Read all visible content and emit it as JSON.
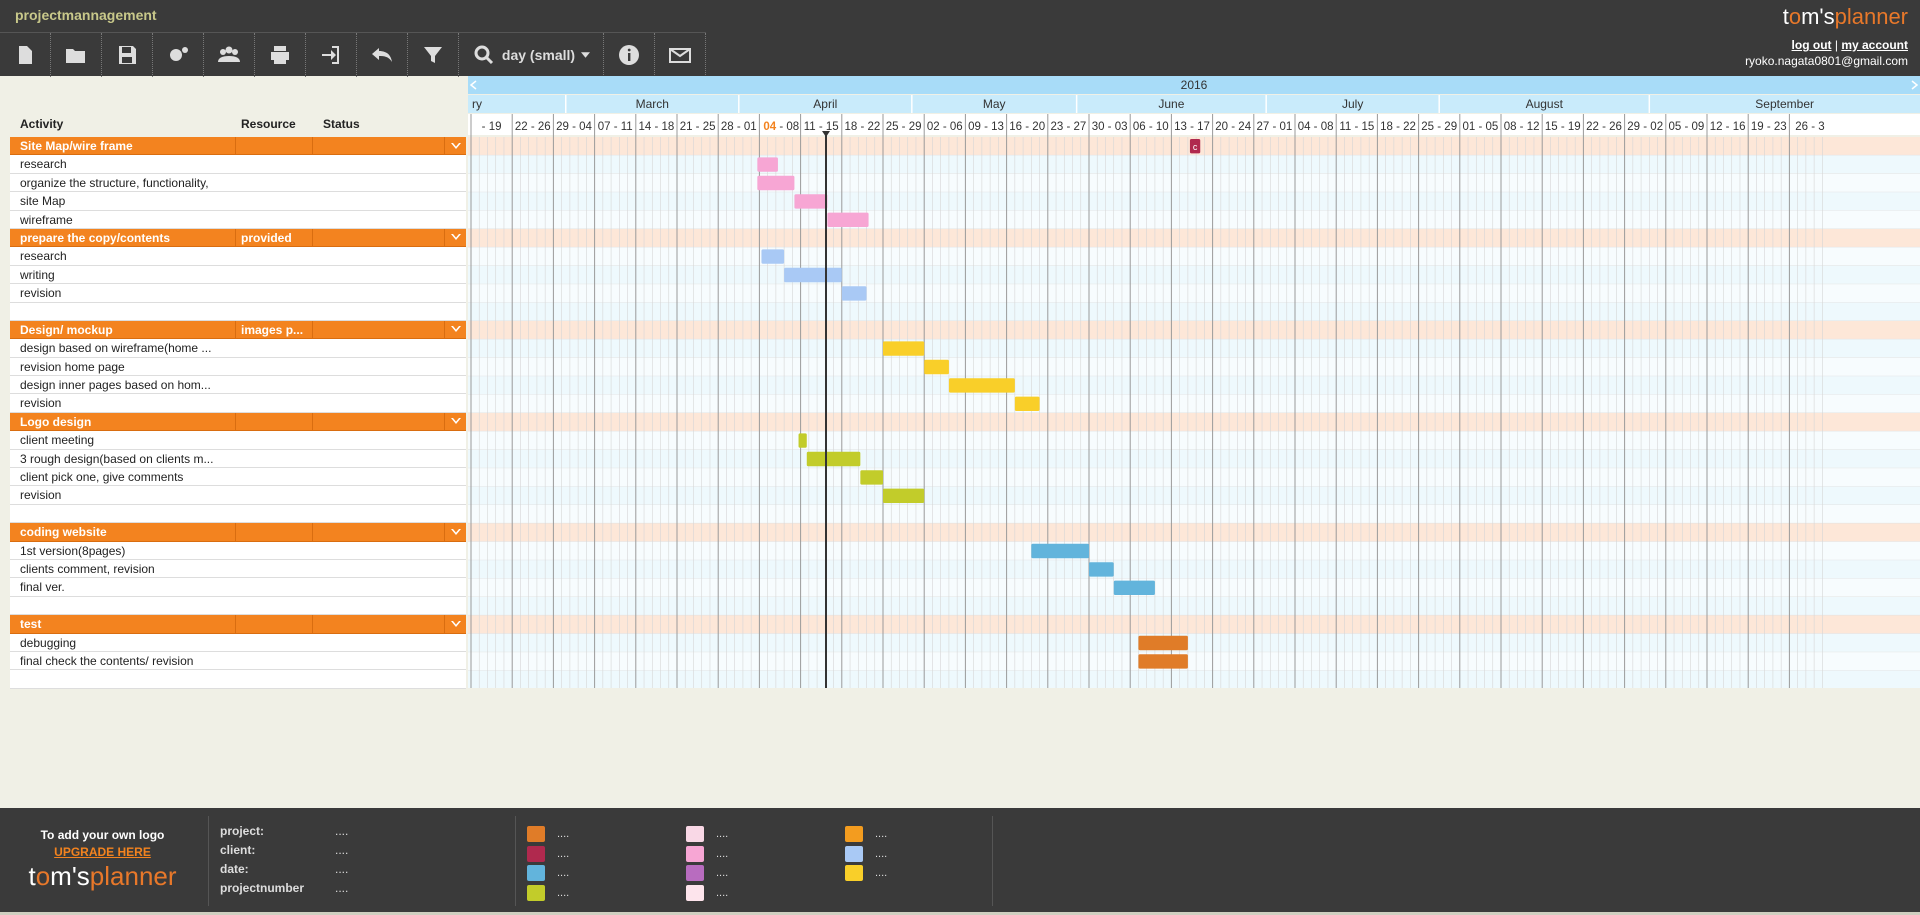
{
  "app": {
    "name": "projectmannagement",
    "logo_pre": "t",
    "logo_mid": "m's",
    "logo_post": "planner",
    "logout": "log out",
    "sep": " | ",
    "myaccount": "my account",
    "user": "ryoko.nagata0801@gmail.com"
  },
  "toolbar": {
    "zoom": "day (small)",
    "icons": [
      "new-file-icon",
      "open-folder-icon",
      "save-icon",
      "settings-icon",
      "users-icon",
      "print-icon",
      "export-icon",
      "undo-icon",
      "filter-icon",
      "zoom-search-icon",
      "info-icon",
      "mail-icon"
    ]
  },
  "columns": {
    "activity": "Activity",
    "resource": "Resource",
    "status": "Status"
  },
  "timeline": {
    "year": "2016",
    "months": [
      "ry",
      "March",
      "April",
      "May",
      "June",
      "July",
      "August",
      "September"
    ],
    "weeks": [
      "- 19",
      "22 - 26",
      "29 - 04",
      "07 - 11",
      "14 - 18",
      "21 - 25",
      "28 - 01",
      "04 - 08",
      "11 - 15",
      "18 - 22",
      "25 - 29",
      "02 - 06",
      "09 - 13",
      "16 - 20",
      "23 - 27",
      "30 - 03",
      "06 - 10",
      "13 - 17",
      "20 - 24",
      "27 - 01",
      "04 - 08",
      "11 - 15",
      "18 - 22",
      "25 - 29",
      "01 - 05",
      "08 - 12",
      "15 - 19",
      "22 - 26",
      "29 - 02",
      "05 - 09",
      "12 - 16",
      "19 - 23",
      "26 - 3"
    ],
    "today_label": "04",
    "today_week": 7,
    "marker_x": 0.615
  },
  "rows": [
    {
      "type": "group",
      "activity": "Site Map/wire frame",
      "resource": "",
      "status": ""
    },
    {
      "activity": "research"
    },
    {
      "activity": "organize the structure, functionality,"
    },
    {
      "activity": "site Map"
    },
    {
      "activity": "wireframe"
    },
    {
      "type": "group",
      "activity": "prepare the copy/contents",
      "resource": "provided",
      "status": ""
    },
    {
      "activity": "research"
    },
    {
      "activity": "writing"
    },
    {
      "activity": "revision"
    },
    {
      "activity": ""
    },
    {
      "type": "group",
      "activity": "Design/ mockup",
      "resource": "images p...",
      "status": ""
    },
    {
      "activity": "design based on wireframe(home ..."
    },
    {
      "activity": "revision home page"
    },
    {
      "activity": "design inner pages based on hom..."
    },
    {
      "activity": "revision"
    },
    {
      "type": "group",
      "activity": "Logo design",
      "resource": "",
      "status": ""
    },
    {
      "activity": "client meeting"
    },
    {
      "activity": "3 rough design(based on clients m..."
    },
    {
      "activity": "client pick one, give comments"
    },
    {
      "activity": "revision"
    },
    {
      "activity": ""
    },
    {
      "type": "group",
      "activity": "coding website",
      "resource": "",
      "status": ""
    },
    {
      "activity": "1st version(8pages)"
    },
    {
      "activity": "clients comment, revision"
    },
    {
      "activity": "final ver."
    },
    {
      "activity": ""
    },
    {
      "type": "group",
      "activity": "test",
      "resource": "",
      "status": ""
    },
    {
      "activity": "debugging"
    },
    {
      "activity": "final check the contents/ revision"
    },
    {
      "activity": ""
    }
  ],
  "bars": [
    {
      "row": 0,
      "start": 17.45,
      "end": 17.7,
      "color": "#b0294e",
      "label": "c"
    },
    {
      "row": 1,
      "start": 6.95,
      "end": 7.45,
      "color": "#f7a6d4"
    },
    {
      "row": 2,
      "start": 6.95,
      "end": 7.85,
      "color": "#f7a6d4"
    },
    {
      "row": 3,
      "start": 7.85,
      "end": 8.65,
      "color": "#f7a6d4"
    },
    {
      "row": 4,
      "start": 8.65,
      "end": 9.65,
      "color": "#f7a6d4"
    },
    {
      "row": 6,
      "start": 7.05,
      "end": 7.6,
      "color": "#a9c9f5"
    },
    {
      "row": 7,
      "start": 7.6,
      "end": 9.0,
      "color": "#a9c9f5"
    },
    {
      "row": 8,
      "start": 9.0,
      "end": 9.6,
      "color": "#a9c9f5"
    },
    {
      "row": 11,
      "start": 10.0,
      "end": 11.0,
      "color": "#f9cf29"
    },
    {
      "row": 12,
      "start": 11.0,
      "end": 11.6,
      "color": "#f9cf29"
    },
    {
      "row": 13,
      "start": 11.6,
      "end": 13.2,
      "color": "#f9cf29"
    },
    {
      "row": 14,
      "start": 13.2,
      "end": 13.8,
      "color": "#f9cf29"
    },
    {
      "row": 16,
      "start": 7.95,
      "end": 8.15,
      "color": "#c2cc2a"
    },
    {
      "row": 17,
      "start": 8.15,
      "end": 9.45,
      "color": "#c2cc2a"
    },
    {
      "row": 18,
      "start": 9.45,
      "end": 10.0,
      "color": "#c2cc2a"
    },
    {
      "row": 19,
      "start": 10.0,
      "end": 11.0,
      "color": "#c2cc2a"
    },
    {
      "row": 22,
      "start": 13.6,
      "end": 15.0,
      "color": "#62b4dc"
    },
    {
      "row": 23,
      "start": 15.0,
      "end": 15.6,
      "color": "#62b4dc"
    },
    {
      "row": 24,
      "start": 15.6,
      "end": 16.6,
      "color": "#62b4dc"
    },
    {
      "row": 27,
      "start": 16.2,
      "end": 17.4,
      "color": "#e07c28"
    },
    {
      "row": 28,
      "start": 16.2,
      "end": 17.4,
      "color": "#e07c28"
    }
  ],
  "footer": {
    "add_logo": "To add your own logo",
    "upgrade": "UPGRADE HERE",
    "meta": [
      {
        "k": "project:",
        "v": "...."
      },
      {
        "k": "client:",
        "v": "...."
      },
      {
        "k": "date:",
        "v": "...."
      },
      {
        "k": "projectnumber",
        "v": "...."
      }
    ],
    "legend": [
      [
        {
          "c": "#e07c28",
          "t": "...."
        },
        {
          "c": "#b0294e",
          "t": "...."
        },
        {
          "c": "#62b4dc",
          "t": "...."
        },
        {
          "c": "#c2cc2a",
          "t": "...."
        }
      ],
      [
        {
          "c": "#f9d8e6",
          "t": "...."
        },
        {
          "c": "#f7a6d4",
          "t": "...."
        },
        {
          "c": "#b86cbf",
          "t": "...."
        },
        {
          "c": "#fde4ec",
          "t": "...."
        }
      ],
      [
        {
          "c": "#f39c1f",
          "t": "...."
        },
        {
          "c": "#a9c9f5",
          "t": "...."
        },
        {
          "c": "#f9cf29",
          "t": "...."
        }
      ]
    ]
  }
}
